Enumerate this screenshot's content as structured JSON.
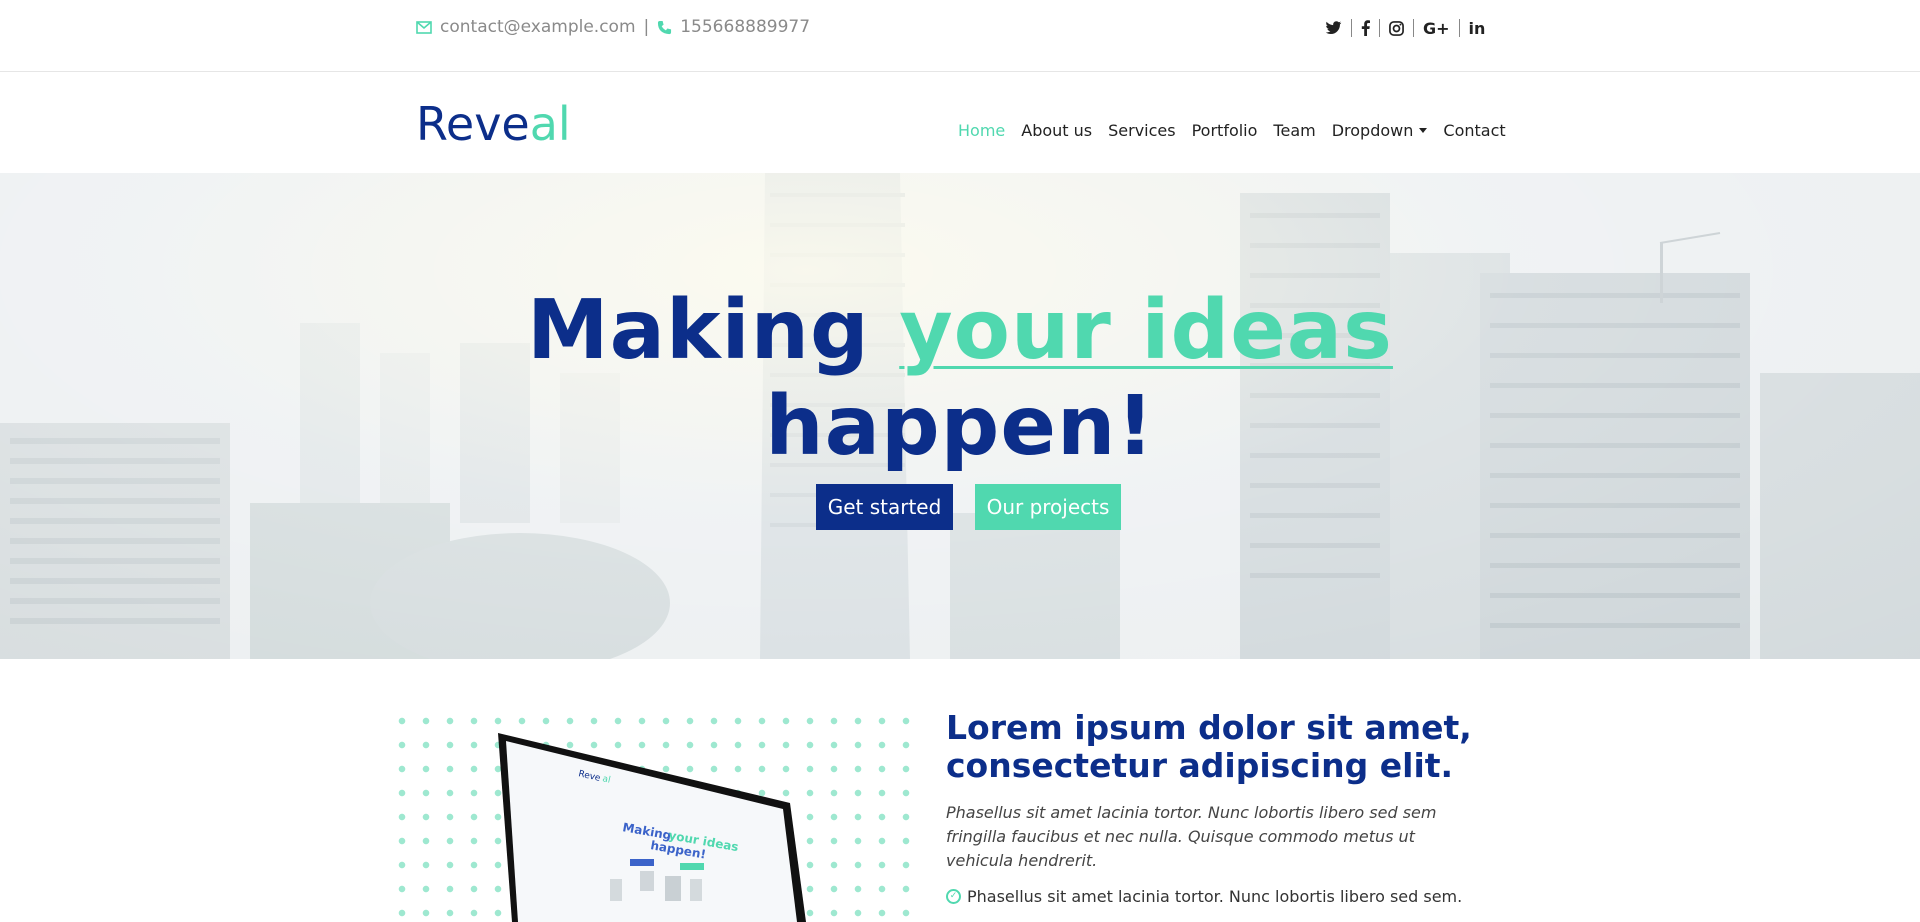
{
  "topbar": {
    "email": "contact@example.com",
    "separator": "|",
    "phone": "155668889977",
    "social": [
      {
        "icon": "twitter-icon",
        "glyph": "𝕥"
      },
      {
        "icon": "facebook-icon",
        "glyph": "f"
      },
      {
        "icon": "instagram-icon",
        "glyph": "◎"
      },
      {
        "icon": "google-plus-icon",
        "glyph": "G+"
      },
      {
        "icon": "linkedin-icon",
        "glyph": "in"
      }
    ]
  },
  "brand": {
    "main": "Reve",
    "accent": "al"
  },
  "nav": {
    "items": [
      "Home",
      "About us",
      "Services",
      "Portfolio",
      "Team",
      "Dropdown",
      "Contact"
    ],
    "active": "Home"
  },
  "hero": {
    "title_start": "Making ",
    "title_highlight": "your ideas",
    "title_end": "happen!",
    "primary_button": "Get started",
    "secondary_button": "Our projects"
  },
  "about": {
    "title": "Lorem ipsum dolor sit amet, consectetur adipiscing elit.",
    "lead": "Phasellus sit amet lacinia tortor. Nunc lobortis libero sed sem fringilla faucibus et nec nulla. Quisque commodo metus ut vehicula hendrerit.",
    "items": [
      "Phasellus sit amet lacinia tortor. Nunc lobortis libero sed sem."
    ],
    "laptop_title_start": "Making ",
    "laptop_title_highlight": "your ideas",
    "laptop_title_end": "happen!",
    "laptop_brand_main": "Reve",
    "laptop_brand_accent": "al"
  },
  "colors": {
    "brand": "#0c2e8a",
    "accent": "#50d8af"
  }
}
